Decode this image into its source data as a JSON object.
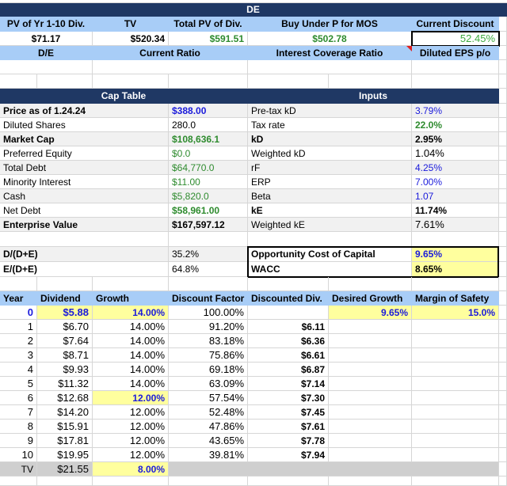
{
  "summary": {
    "title": "DE",
    "headers1": [
      "PV of Yr 1-10 Div.",
      "TV",
      "Total PV of Div.",
      "Buy Under P for MOS",
      "Current Discount"
    ],
    "values1": {
      "pv_yr_1_10_div": "$71.17",
      "tv": "$520.34",
      "total_pv_div": "$591.51",
      "buy_under_p": "$502.78",
      "current_discount": "52.45%"
    },
    "headers2": [
      "D/E",
      "Current Ratio",
      "Interest Coverage Ratio",
      "Diluted EPS p/o"
    ]
  },
  "cap_table": {
    "title": "Cap Table",
    "rows": [
      {
        "label": "Price as of 1.24.24",
        "value": "$388.00"
      },
      {
        "label": "Diluted Shares",
        "value": "280.0"
      },
      {
        "label": "Market Cap",
        "value": "$108,636.1"
      },
      {
        "label": "Preferred Equity",
        "value": "$0.0"
      },
      {
        "label": "Total Debt",
        "value": "$64,770.0"
      },
      {
        "label": "Minority Interest",
        "value": "$11.00"
      },
      {
        "label": "Cash",
        "value": "$5,820.0"
      },
      {
        "label": "Net Debt",
        "value": "$58,961.00"
      },
      {
        "label": "Enterprise Value",
        "value": "$167,597.12"
      }
    ],
    "weights": [
      {
        "label": "D/(D+E)",
        "value": "35.2%"
      },
      {
        "label": "E/(D+E)",
        "value": "64.8%"
      }
    ]
  },
  "inputs": {
    "title": "Inputs",
    "rows": [
      {
        "label": "Pre-tax kD",
        "value": "3.79%"
      },
      {
        "label": "Tax rate",
        "value": "22.0%"
      },
      {
        "label": "kD",
        "value": "2.95%"
      },
      {
        "label": "Weighted kD",
        "value": "1.04%"
      },
      {
        "label": "rF",
        "value": "4.25%"
      },
      {
        "label": "ERP",
        "value": "7.00%"
      },
      {
        "label": "Beta",
        "value": "1.07"
      },
      {
        "label": "kE",
        "value": "11.74%"
      },
      {
        "label": "Weighted kE",
        "value": "7.61%"
      }
    ],
    "capital": [
      {
        "label": "Opportunity Cost of Capital",
        "value": "9.65%"
      },
      {
        "label": "WACC",
        "value": "8.65%"
      }
    ]
  },
  "dividend_table": {
    "headers": [
      "Year",
      "Dividend",
      "Growth",
      "Discount Factor",
      "Discounted Div.",
      "Desired Growth",
      "Margin of Safety"
    ],
    "desired_growth": "9.65%",
    "margin_of_safety": "15.0%",
    "rows": [
      {
        "year": "0",
        "dividend": "$5.88",
        "growth": "14.00%",
        "factor": "100.00%",
        "discounted": ""
      },
      {
        "year": "1",
        "dividend": "$6.70",
        "growth": "14.00%",
        "factor": "91.20%",
        "discounted": "$6.11"
      },
      {
        "year": "2",
        "dividend": "$7.64",
        "growth": "14.00%",
        "factor": "83.18%",
        "discounted": "$6.36"
      },
      {
        "year": "3",
        "dividend": "$8.71",
        "growth": "14.00%",
        "factor": "75.86%",
        "discounted": "$6.61"
      },
      {
        "year": "4",
        "dividend": "$9.93",
        "growth": "14.00%",
        "factor": "69.18%",
        "discounted": "$6.87"
      },
      {
        "year": "5",
        "dividend": "$11.32",
        "growth": "14.00%",
        "factor": "63.09%",
        "discounted": "$7.14"
      },
      {
        "year": "6",
        "dividend": "$12.68",
        "growth": "12.00%",
        "factor": "57.54%",
        "discounted": "$7.30"
      },
      {
        "year": "7",
        "dividend": "$14.20",
        "growth": "12.00%",
        "factor": "52.48%",
        "discounted": "$7.45"
      },
      {
        "year": "8",
        "dividend": "$15.91",
        "growth": "12.00%",
        "factor": "47.86%",
        "discounted": "$7.61"
      },
      {
        "year": "9",
        "dividend": "$17.81",
        "growth": "12.00%",
        "factor": "43.65%",
        "discounted": "$7.78"
      },
      {
        "year": "10",
        "dividend": "$19.95",
        "growth": "12.00%",
        "factor": "39.81%",
        "discounted": "$7.94"
      }
    ],
    "tv_row": {
      "year": "TV",
      "dividend": "$21.55",
      "growth": "8.00%"
    }
  },
  "colors": {
    "header_navy": "#1f3864",
    "header_light_blue": "#a8cdf7",
    "input_blue": "#1a1adb",
    "link_green": "#2e8b2e",
    "highlight_yellow": "#ffff9e",
    "comment_flag_red": "#e02020"
  }
}
